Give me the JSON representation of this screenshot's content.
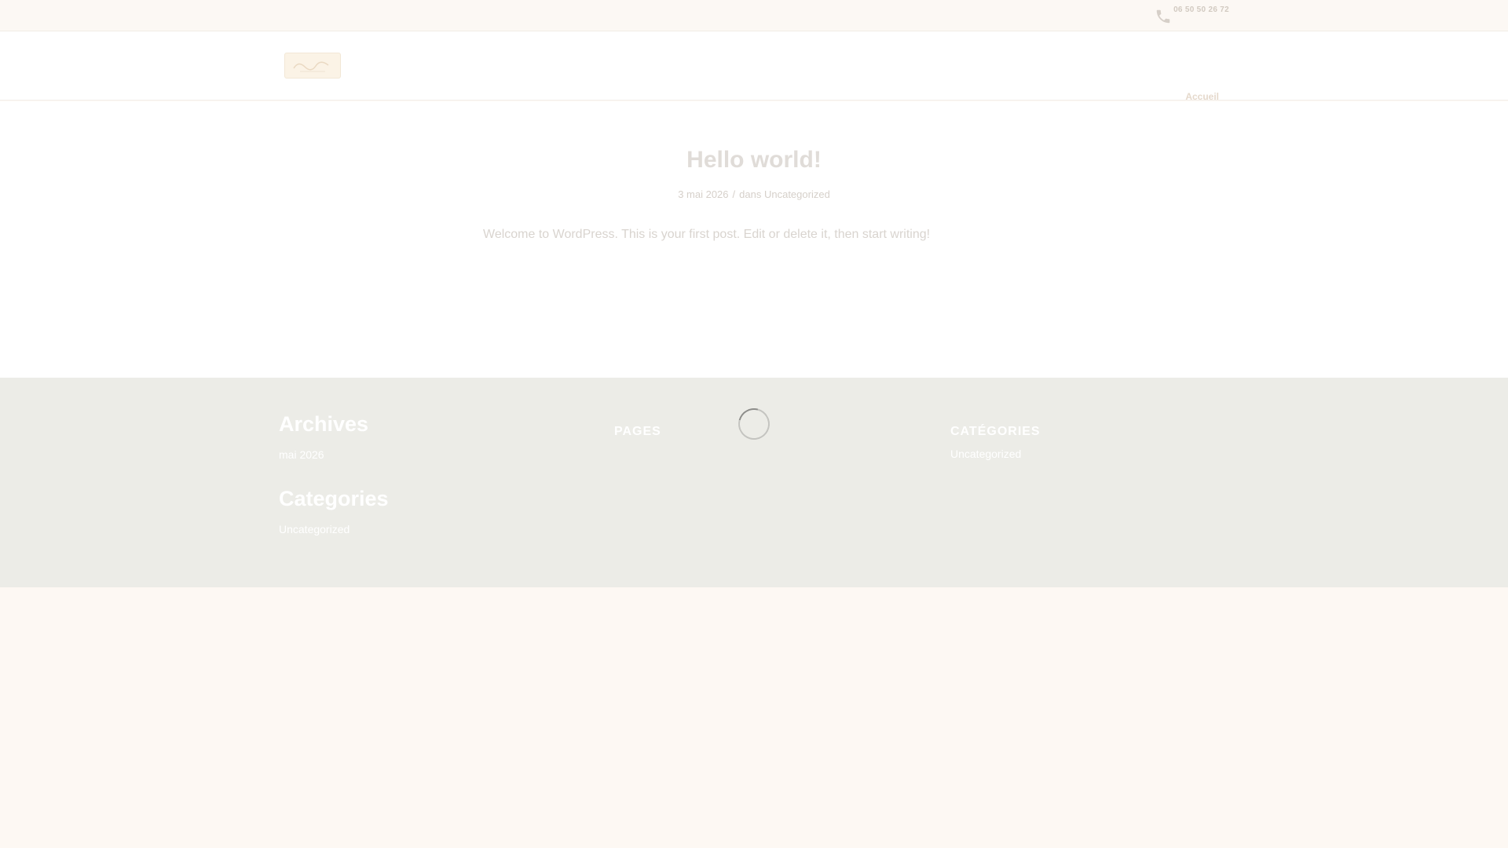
{
  "topbar": {
    "phone": "06 50 50 26 72",
    "phone_icon": "phone-icon"
  },
  "header": {
    "logo_icon": "site-logo",
    "nav": [
      {
        "label": "Accueil"
      }
    ]
  },
  "post": {
    "title": "Hello world!",
    "date": "3 mai 2026",
    "meta_separator": "/",
    "category_prefix": "dans",
    "category": "Uncategorized",
    "body": "Welcome to WordPress. This is your first post. Edit or delete it, then start writing!"
  },
  "footer": {
    "archives": {
      "title": "Archives",
      "items": [
        "mai 2026"
      ]
    },
    "categories": {
      "title": "Categories",
      "items": [
        "Uncategorized"
      ]
    },
    "pages": {
      "title": "PAGES",
      "loading_icon": "spinner-icon"
    },
    "categories_right": {
      "title": "CATÉGORIES",
      "items": [
        "Uncategorized"
      ]
    }
  },
  "colors": {
    "page_background": "#fdf8f3",
    "footer_background": "#ecece7",
    "content_background": "#ffffff"
  }
}
